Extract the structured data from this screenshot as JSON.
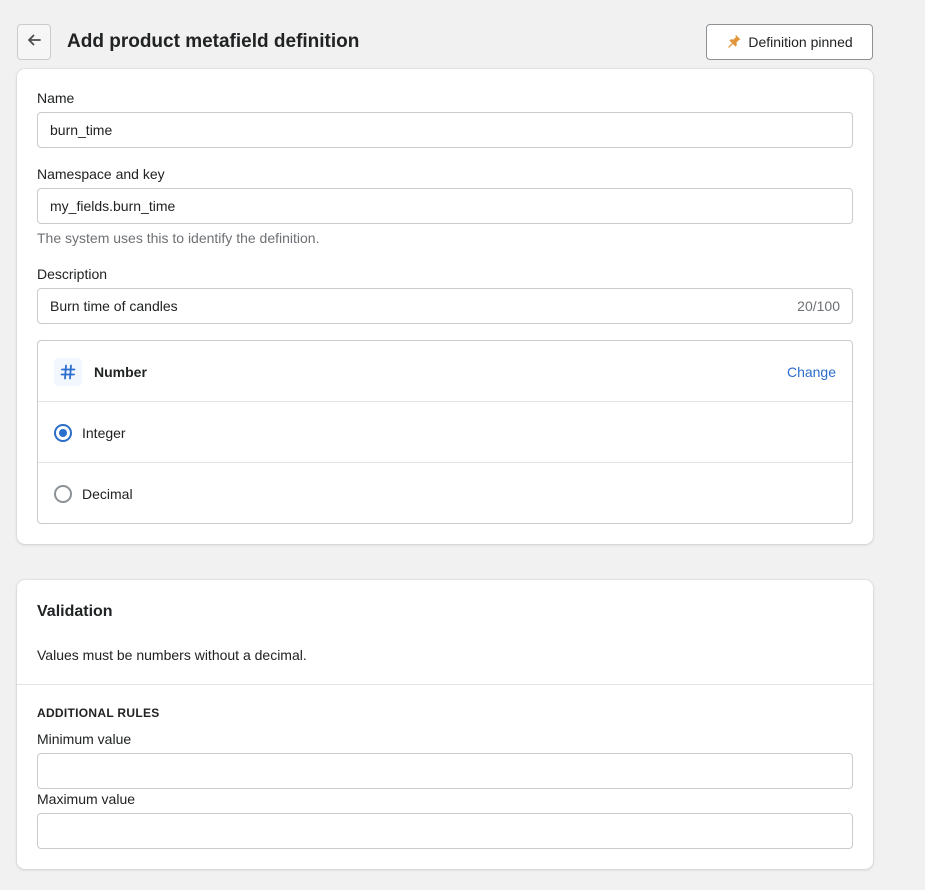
{
  "header": {
    "title": "Add product metafield definition",
    "pin_label": "Definition pinned",
    "back_icon": "arrow-left-icon",
    "pin_icon": "pin-icon",
    "pin_color": "#e1963c"
  },
  "form": {
    "name": {
      "label": "Name",
      "value": "burn_time"
    },
    "namespace": {
      "label": "Namespace and key",
      "value": "my_fields.burn_time",
      "help": "The system uses this to identify the definition."
    },
    "description": {
      "label": "Description",
      "value": "Burn time of candles",
      "counter": "20/100"
    },
    "type": {
      "name": "Number",
      "icon": "hash-icon",
      "change_label": "Change",
      "options": [
        {
          "label": "Integer",
          "selected": true
        },
        {
          "label": "Decimal",
          "selected": false
        }
      ]
    }
  },
  "validation": {
    "title": "Validation",
    "text": "Values must be numbers without a decimal.",
    "subheading": "ADDITIONAL RULES",
    "min_label": "Minimum value",
    "min_value": "",
    "max_label": "Maximum value",
    "max_value": ""
  },
  "colors": {
    "accent": "#2c6ecb",
    "border": "#c9cccf",
    "background": "#f1f1f1"
  }
}
